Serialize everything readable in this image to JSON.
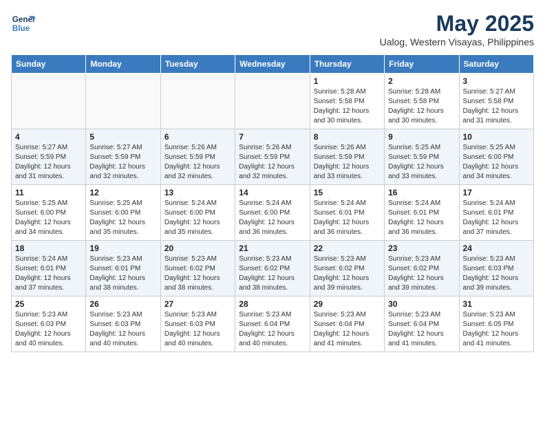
{
  "header": {
    "logo_line1": "General",
    "logo_line2": "Blue",
    "title": "May 2025",
    "subtitle": "Ualog, Western Visayas, Philippines"
  },
  "calendar": {
    "days_of_week": [
      "Sunday",
      "Monday",
      "Tuesday",
      "Wednesday",
      "Thursday",
      "Friday",
      "Saturday"
    ],
    "weeks": [
      [
        {
          "day": "",
          "info": ""
        },
        {
          "day": "",
          "info": ""
        },
        {
          "day": "",
          "info": ""
        },
        {
          "day": "",
          "info": ""
        },
        {
          "day": "1",
          "info": "Sunrise: 5:28 AM\nSunset: 5:58 PM\nDaylight: 12 hours\nand 30 minutes."
        },
        {
          "day": "2",
          "info": "Sunrise: 5:28 AM\nSunset: 5:58 PM\nDaylight: 12 hours\nand 30 minutes."
        },
        {
          "day": "3",
          "info": "Sunrise: 5:27 AM\nSunset: 5:58 PM\nDaylight: 12 hours\nand 31 minutes."
        }
      ],
      [
        {
          "day": "4",
          "info": "Sunrise: 5:27 AM\nSunset: 5:59 PM\nDaylight: 12 hours\nand 31 minutes."
        },
        {
          "day": "5",
          "info": "Sunrise: 5:27 AM\nSunset: 5:59 PM\nDaylight: 12 hours\nand 32 minutes."
        },
        {
          "day": "6",
          "info": "Sunrise: 5:26 AM\nSunset: 5:59 PM\nDaylight: 12 hours\nand 32 minutes."
        },
        {
          "day": "7",
          "info": "Sunrise: 5:26 AM\nSunset: 5:59 PM\nDaylight: 12 hours\nand 32 minutes."
        },
        {
          "day": "8",
          "info": "Sunrise: 5:26 AM\nSunset: 5:59 PM\nDaylight: 12 hours\nand 33 minutes."
        },
        {
          "day": "9",
          "info": "Sunrise: 5:25 AM\nSunset: 5:59 PM\nDaylight: 12 hours\nand 33 minutes."
        },
        {
          "day": "10",
          "info": "Sunrise: 5:25 AM\nSunset: 6:00 PM\nDaylight: 12 hours\nand 34 minutes."
        }
      ],
      [
        {
          "day": "11",
          "info": "Sunrise: 5:25 AM\nSunset: 6:00 PM\nDaylight: 12 hours\nand 34 minutes."
        },
        {
          "day": "12",
          "info": "Sunrise: 5:25 AM\nSunset: 6:00 PM\nDaylight: 12 hours\nand 35 minutes."
        },
        {
          "day": "13",
          "info": "Sunrise: 5:24 AM\nSunset: 6:00 PM\nDaylight: 12 hours\nand 35 minutes."
        },
        {
          "day": "14",
          "info": "Sunrise: 5:24 AM\nSunset: 6:00 PM\nDaylight: 12 hours\nand 36 minutes."
        },
        {
          "day": "15",
          "info": "Sunrise: 5:24 AM\nSunset: 6:01 PM\nDaylight: 12 hours\nand 36 minutes."
        },
        {
          "day": "16",
          "info": "Sunrise: 5:24 AM\nSunset: 6:01 PM\nDaylight: 12 hours\nand 36 minutes."
        },
        {
          "day": "17",
          "info": "Sunrise: 5:24 AM\nSunset: 6:01 PM\nDaylight: 12 hours\nand 37 minutes."
        }
      ],
      [
        {
          "day": "18",
          "info": "Sunrise: 5:24 AM\nSunset: 6:01 PM\nDaylight: 12 hours\nand 37 minutes."
        },
        {
          "day": "19",
          "info": "Sunrise: 5:23 AM\nSunset: 6:01 PM\nDaylight: 12 hours\nand 38 minutes."
        },
        {
          "day": "20",
          "info": "Sunrise: 5:23 AM\nSunset: 6:02 PM\nDaylight: 12 hours\nand 38 minutes."
        },
        {
          "day": "21",
          "info": "Sunrise: 5:23 AM\nSunset: 6:02 PM\nDaylight: 12 hours\nand 38 minutes."
        },
        {
          "day": "22",
          "info": "Sunrise: 5:23 AM\nSunset: 6:02 PM\nDaylight: 12 hours\nand 39 minutes."
        },
        {
          "day": "23",
          "info": "Sunrise: 5:23 AM\nSunset: 6:02 PM\nDaylight: 12 hours\nand 39 minutes."
        },
        {
          "day": "24",
          "info": "Sunrise: 5:23 AM\nSunset: 6:03 PM\nDaylight: 12 hours\nand 39 minutes."
        }
      ],
      [
        {
          "day": "25",
          "info": "Sunrise: 5:23 AM\nSunset: 6:03 PM\nDaylight: 12 hours\nand 40 minutes."
        },
        {
          "day": "26",
          "info": "Sunrise: 5:23 AM\nSunset: 6:03 PM\nDaylight: 12 hours\nand 40 minutes."
        },
        {
          "day": "27",
          "info": "Sunrise: 5:23 AM\nSunset: 6:03 PM\nDaylight: 12 hours\nand 40 minutes."
        },
        {
          "day": "28",
          "info": "Sunrise: 5:23 AM\nSunset: 6:04 PM\nDaylight: 12 hours\nand 40 minutes."
        },
        {
          "day": "29",
          "info": "Sunrise: 5:23 AM\nSunset: 6:04 PM\nDaylight: 12 hours\nand 41 minutes."
        },
        {
          "day": "30",
          "info": "Sunrise: 5:23 AM\nSunset: 6:04 PM\nDaylight: 12 hours\nand 41 minutes."
        },
        {
          "day": "31",
          "info": "Sunrise: 5:23 AM\nSunset: 6:05 PM\nDaylight: 12 hours\nand 41 minutes."
        }
      ]
    ]
  }
}
